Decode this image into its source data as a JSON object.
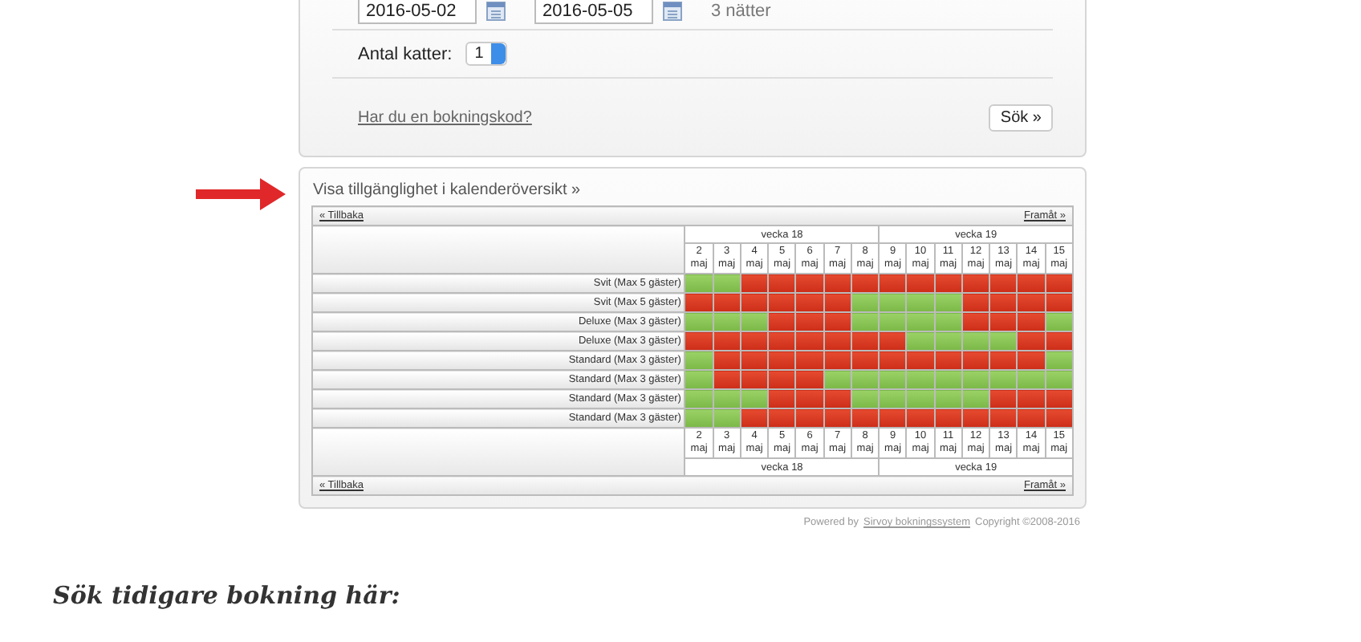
{
  "booking_form": {
    "check_in": "2016-05-02",
    "check_out": "2016-05-05",
    "nights": "3 nätter",
    "cats_label": "Antal katter:",
    "cats_value": "1",
    "code_link": "Har du en bokningskod?",
    "search_button": "Sök »"
  },
  "calendar": {
    "title": "Visa tillgänglighet i kalenderöversikt »",
    "top": {
      "back": "« Tillbaka",
      "forward": "Framåt »",
      "weeks": [
        "vecka 18",
        "vecka 19"
      ],
      "days": [
        {
          "day": "2",
          "month": "maj"
        },
        {
          "day": "3",
          "month": "maj"
        },
        {
          "day": "4",
          "month": "maj"
        },
        {
          "day": "5",
          "month": "maj"
        },
        {
          "day": "6",
          "month": "maj"
        },
        {
          "day": "7",
          "month": "maj"
        },
        {
          "day": "8",
          "month": "maj"
        },
        {
          "day": "9",
          "month": "maj"
        },
        {
          "day": "10",
          "month": "maj"
        },
        {
          "day": "11",
          "month": "maj"
        },
        {
          "day": "12",
          "month": "maj"
        },
        {
          "day": "13",
          "month": "maj"
        },
        {
          "day": "14",
          "month": "maj"
        },
        {
          "day": "15",
          "month": "maj"
        }
      ]
    },
    "bottom": {
      "days": [
        {
          "day": "2",
          "month": "maj"
        },
        {
          "day": "3",
          "month": "maj"
        },
        {
          "day": "4",
          "month": "maj"
        },
        {
          "day": "5",
          "month": "maj"
        },
        {
          "day": "6",
          "month": "maj"
        },
        {
          "day": "7",
          "month": "maj"
        },
        {
          "day": "8",
          "month": "maj"
        },
        {
          "day": "9",
          "month": "maj"
        },
        {
          "day": "10",
          "month": "maj"
        },
        {
          "day": "11",
          "month": "maj"
        },
        {
          "day": "12",
          "month": "maj"
        },
        {
          "day": "13",
          "month": "maj"
        },
        {
          "day": "14",
          "month": "maj"
        },
        {
          "day": "15",
          "month": "maj"
        }
      ],
      "weeks": [
        "vecka 18",
        "vecka 19"
      ],
      "back": "« Tillbaka",
      "forward": "Framåt »"
    },
    "rooms": [
      {
        "name": "Svit (Max 5 gäster)",
        "available": [
          true,
          true,
          false,
          false,
          false,
          false,
          false,
          false,
          false,
          false,
          false,
          false,
          false,
          false
        ]
      },
      {
        "name": "Svit (Max 5 gäster)",
        "available": [
          false,
          false,
          false,
          false,
          false,
          false,
          true,
          true,
          true,
          true,
          false,
          false,
          false,
          false
        ]
      },
      {
        "name": "Deluxe (Max 3 gäster)",
        "available": [
          true,
          true,
          true,
          false,
          false,
          false,
          true,
          true,
          true,
          true,
          false,
          false,
          false,
          true
        ]
      },
      {
        "name": "Deluxe (Max 3 gäster)",
        "available": [
          false,
          false,
          false,
          false,
          false,
          false,
          false,
          false,
          true,
          true,
          true,
          true,
          false,
          false
        ]
      },
      {
        "name": "Standard (Max 3 gäster)",
        "available": [
          true,
          false,
          false,
          false,
          false,
          false,
          false,
          false,
          false,
          false,
          false,
          false,
          false,
          true
        ]
      },
      {
        "name": "Standard (Max 3 gäster)",
        "available": [
          true,
          false,
          false,
          false,
          false,
          true,
          true,
          true,
          true,
          true,
          true,
          true,
          true,
          true
        ]
      },
      {
        "name": "Standard (Max 3 gäster)",
        "available": [
          true,
          true,
          true,
          false,
          false,
          false,
          true,
          true,
          true,
          true,
          true,
          false,
          false,
          false
        ]
      },
      {
        "name": "Standard (Max 3 gäster)",
        "available": [
          true,
          true,
          false,
          false,
          false,
          false,
          false,
          false,
          false,
          false,
          false,
          false,
          false,
          false
        ]
      }
    ]
  },
  "footer": {
    "powered_by": "Powered by",
    "link": "Sirvoy bokningssystem",
    "copyright": "Copyright ©2008-2016"
  },
  "heading": "Sök tidigare bokning här:"
}
